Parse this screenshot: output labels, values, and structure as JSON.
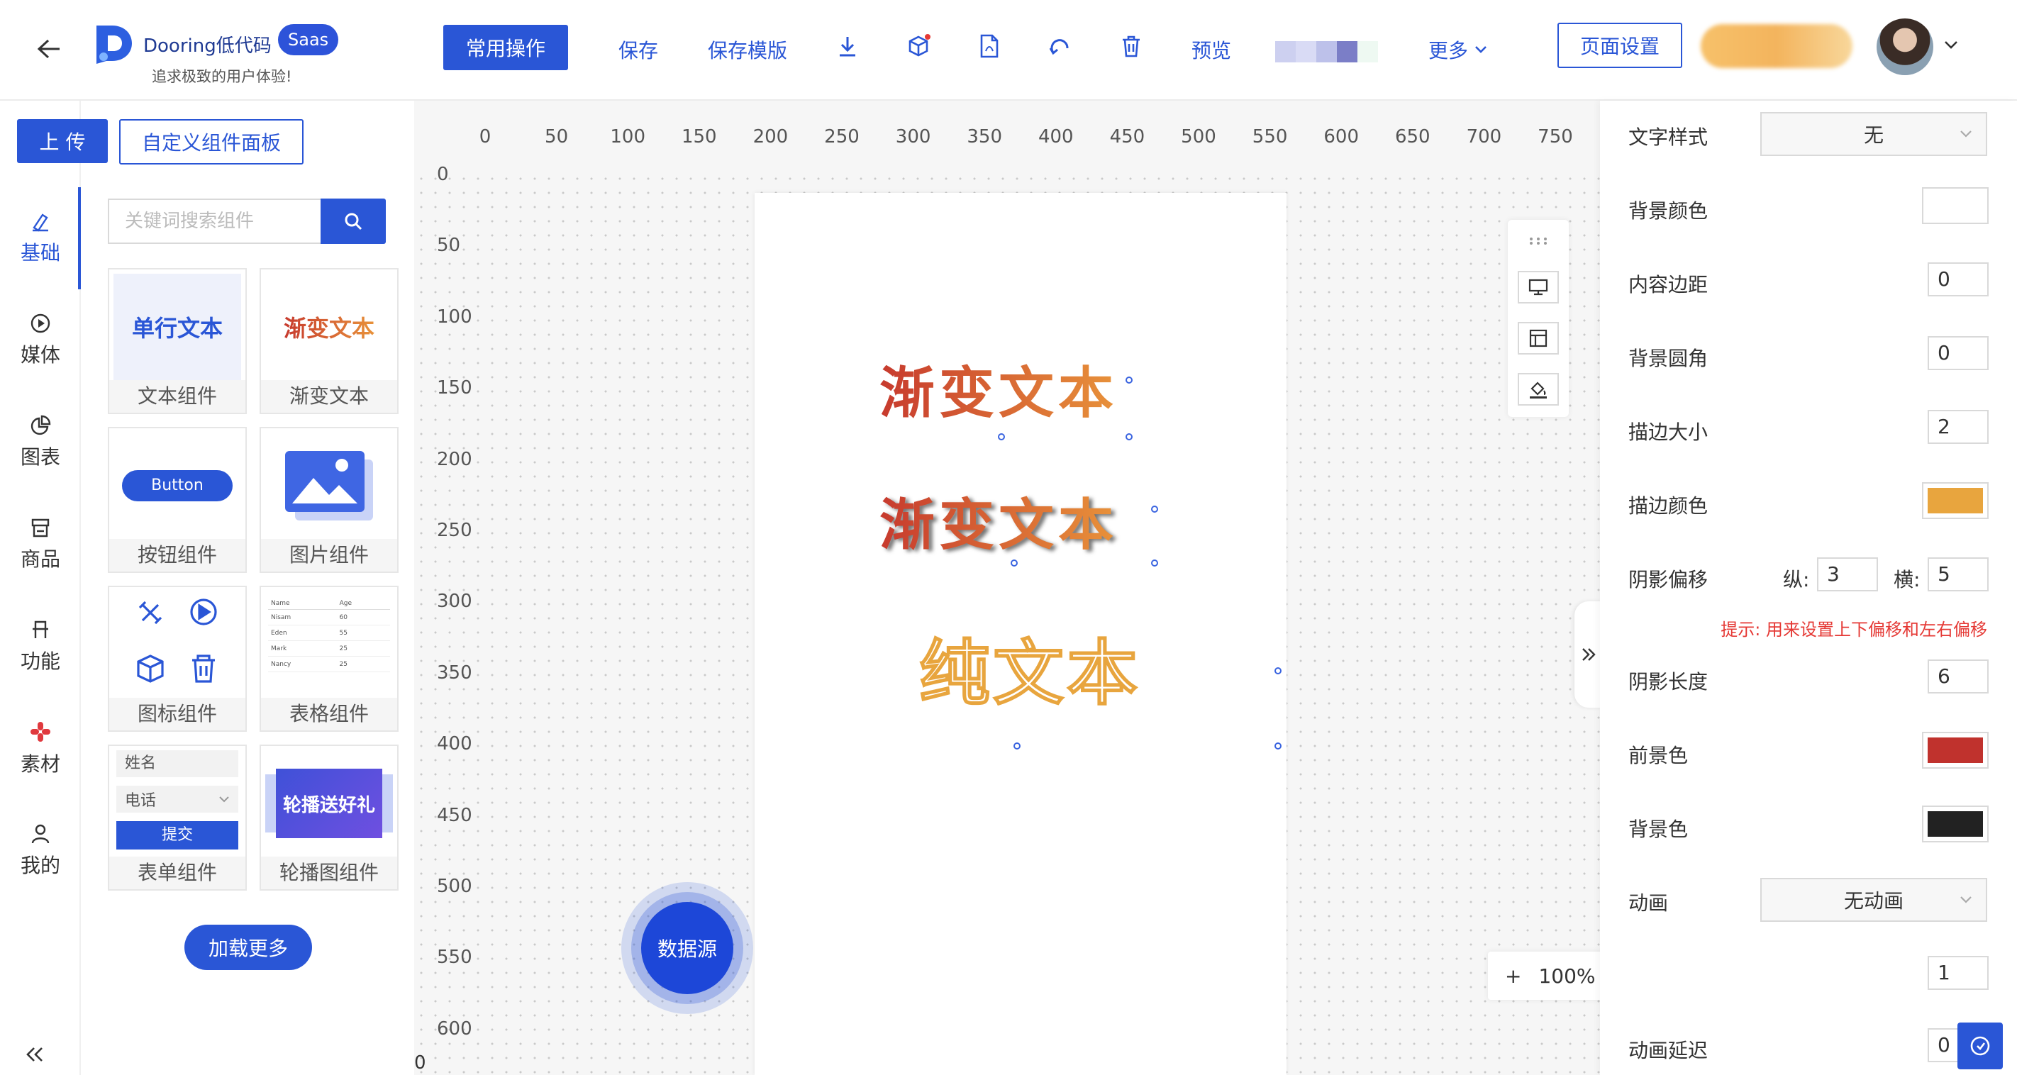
{
  "header": {
    "brand_name": "Dooring低代码",
    "badge": "Saas",
    "slogan": "追求极致的用户体验!",
    "primary_action": "常用操作",
    "save": "保存",
    "save_template": "保存模版",
    "preview": "预览",
    "more": "更多",
    "page_settings": "页面设置"
  },
  "panel": {
    "upload": "上 传",
    "custom_panel": "自定义组件面板",
    "search_placeholder": "关键词搜索组件",
    "load_more": "加载更多"
  },
  "nav": [
    {
      "label": "基础",
      "icon": "pen-icon"
    },
    {
      "label": "媒体",
      "icon": "play-circle-icon"
    },
    {
      "label": "图表",
      "icon": "pie-chart-icon"
    },
    {
      "label": "商品",
      "icon": "shop-icon"
    },
    {
      "label": "功能",
      "icon": "function-icon"
    },
    {
      "label": "素材",
      "icon": "material-icon"
    },
    {
      "label": "我的",
      "icon": "user-icon"
    }
  ],
  "components": [
    {
      "label": "文本组件",
      "thumb": "单行文本"
    },
    {
      "label": "渐变文本",
      "thumb": "渐变文本"
    },
    {
      "label": "按钮组件",
      "thumb": "Button"
    },
    {
      "label": "图片组件",
      "thumb": ""
    },
    {
      "label": "图标组件",
      "thumb": ""
    },
    {
      "label": "表格组件",
      "thumb": ""
    },
    {
      "label": "表单组件",
      "thumb": ""
    },
    {
      "label": "轮播图组件",
      "thumb": "轮播送好礼"
    }
  ],
  "table_thumb": {
    "headers": [
      "Name",
      "Age"
    ],
    "rows": [
      [
        "Nisam",
        "60"
      ],
      [
        "Eden",
        "55"
      ],
      [
        "Mark",
        "25"
      ],
      [
        "Nancy",
        "25"
      ]
    ]
  },
  "form_thumb": {
    "name": "姓名",
    "phone": "电话",
    "submit": "提交"
  },
  "ruler": {
    "x": [
      "0",
      "50",
      "100",
      "150",
      "200",
      "250",
      "300",
      "350",
      "400",
      "450",
      "500",
      "550",
      "600",
      "650",
      "700",
      "750"
    ],
    "y": [
      "0",
      "50",
      "100",
      "150",
      "200",
      "250",
      "300",
      "350",
      "400",
      "450",
      "500",
      "550",
      "600"
    ]
  },
  "canvas": {
    "text1": "渐变文本",
    "text2": "渐变文本",
    "text3": "纯文本",
    "datasource": "数据源",
    "zoom_plus": "+",
    "zoom": "100%",
    "zoom_minus": "-",
    "ruler_corner": "0"
  },
  "props": {
    "text_style_label": "文字样式",
    "text_style_value": "无",
    "bg_color_label": "背景颜色",
    "padding_label": "内容边距",
    "padding_value": "0",
    "radius_label": "背景圆角",
    "radius_value": "0",
    "stroke_size_label": "描边大小",
    "stroke_size_value": "2",
    "stroke_color_label": "描边颜色",
    "stroke_color": "#e8a53e",
    "shadow_offset_label": "阴影偏移",
    "shadow_v_label": "纵:",
    "shadow_v_value": "3",
    "shadow_h_label": "横:",
    "shadow_h_value": "5",
    "hint": "提示: 用来设置上下偏移和左右偏移",
    "shadow_length_label": "阴影长度",
    "shadow_length_value": "6",
    "fg_label": "前景色",
    "fg_color": "#c0322d",
    "bg_label": "背景色",
    "bg_color": "#222222",
    "anim_label": "动画",
    "anim_value": "无动画",
    "anim_count_value": "1",
    "anim_delay_label": "动画延迟",
    "anim_delay_value": "0"
  }
}
